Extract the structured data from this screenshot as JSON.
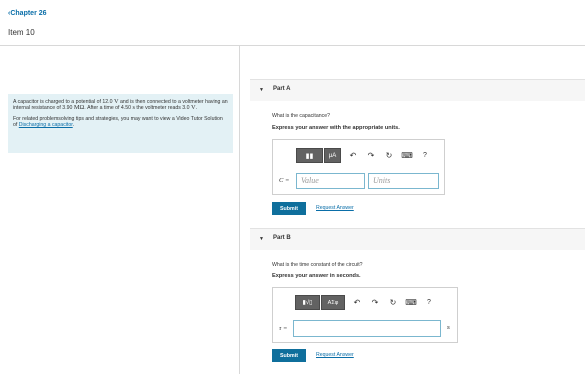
{
  "nav": {
    "back_label": "Chapter 26",
    "back_icon": "chevron-left-icon",
    "item_title": "Item 10"
  },
  "problem": {
    "text_1": "A capacitor is charged to a potential of 12.0",
    "unit_v": "V",
    "text_2": "and is then connected to a voltmeter having an internal resistance of 3.90",
    "unit_mohm": "MΩ",
    "text_3": ". After a time of 4.50",
    "unit_s": "s",
    "text_4": "the voltmeter reads 3.0",
    "unit_v2": "V",
    "text_5": ".",
    "tips_text": "For related problemsolving tips and strategies, you may want to view a Video Tutor Solution of",
    "tips_link": "Discharging a capacitor",
    "tips_end": "."
  },
  "part_a": {
    "caret": "▼",
    "title": "Part A",
    "question": "What is the capacitance?",
    "instruction": "Express your answer with the appropriate units.",
    "toolbar": {
      "templates_glyph": "▮▮",
      "units_glyph": "μA",
      "undo_glyph": "↶",
      "redo_glyph": "↷",
      "reset_glyph": "↻",
      "keyboard_glyph": "⌨",
      "help_glyph": "?"
    },
    "var_label": "C =",
    "value_placeholder": "Value",
    "units_placeholder": "Units",
    "submit_label": "Submit",
    "request_label": "Request Answer"
  },
  "part_b": {
    "caret": "▼",
    "title": "Part B",
    "question": "What is the time constant of the circuit?",
    "instruction": "Express your answer in seconds.",
    "toolbar": {
      "templates_glyph": "▮√▯",
      "symbols_glyph": "ΑΣφ",
      "undo_glyph": "↶",
      "redo_glyph": "↷",
      "reset_glyph": "↻",
      "keyboard_glyph": "⌨",
      "help_glyph": "?"
    },
    "var_label": "τ =",
    "unit_label": "s",
    "submit_label": "Submit",
    "request_label": "Request Answer"
  },
  "colors": {
    "link": "#0a6ea8",
    "submit": "#0f6f9c",
    "problem_bg": "#e3f1f5",
    "input_border": "#7bb7cf"
  }
}
